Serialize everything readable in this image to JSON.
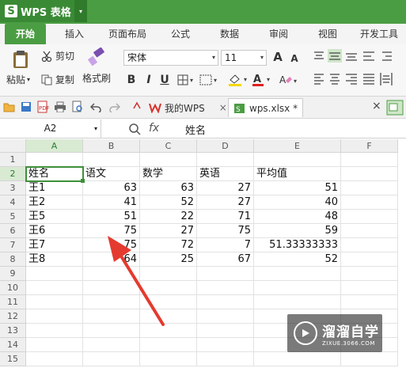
{
  "app": {
    "logo_letter": "S",
    "name": "WPS 表格",
    "caret": "▾"
  },
  "tabs": [
    "开始",
    "插入",
    "页面布局",
    "公式",
    "数据",
    "审阅",
    "视图",
    "开发工具"
  ],
  "ribbon": {
    "paste": "粘贴",
    "cut": "剪切",
    "copy": "复制",
    "format_painter": "格式刷",
    "font_name": "宋体",
    "font_size": "11",
    "grow_font": "A",
    "shrink_font": "A",
    "bold": "B",
    "italic": "I",
    "underline": "U",
    "font_color_letter": "A",
    "font_color": "#e02020",
    "fill_color": "#f5d800"
  },
  "doc_tabs": {
    "tab1": "我的WPS",
    "tab2": "wps.xlsx *"
  },
  "formula_bar": {
    "cell_ref": "A2",
    "fx": "fx",
    "content": "姓名"
  },
  "sheet": {
    "columns": [
      "A",
      "B",
      "C",
      "D",
      "E",
      "F"
    ],
    "rows": [
      "1",
      "2",
      "3",
      "4",
      "5",
      "6",
      "7",
      "8",
      "9",
      "10",
      "11",
      "12",
      "13",
      "14",
      "15"
    ],
    "header_row": [
      "姓名",
      "语文",
      "数学",
      "英语",
      "平均值"
    ],
    "data": [
      [
        "王1",
        "63",
        "63",
        "27",
        "51"
      ],
      [
        "王2",
        "41",
        "52",
        "27",
        "40"
      ],
      [
        "王5",
        "51",
        "22",
        "71",
        "48"
      ],
      [
        "王6",
        "75",
        "27",
        "75",
        "59"
      ],
      [
        "王7",
        "75",
        "72",
        "7",
        "51.33333333"
      ],
      [
        "王8",
        "64",
        "25",
        "67",
        "52"
      ]
    ]
  },
  "watermark": {
    "name": "溜溜自学",
    "url": "ZIXUE.3066.COM"
  },
  "colors": {
    "brand": "#4b9d43",
    "selection": "#3f8f3a",
    "arrow": "#e53a2f"
  }
}
